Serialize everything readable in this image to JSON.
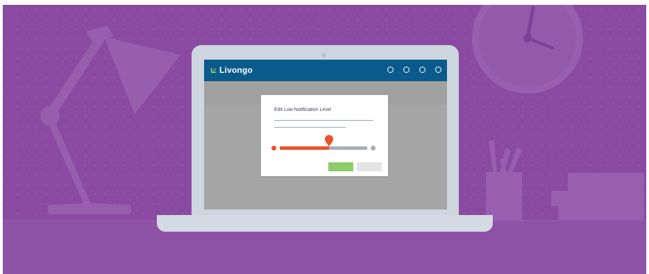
{
  "app": {
    "brand_name": "Livongo",
    "logo_icon": "livongo-leaf-icon",
    "header_color": "#0b5a8c",
    "nav_dots": [
      "nav-dot-1",
      "nav-dot-2",
      "nav-dot-3",
      "nav-dot-4"
    ]
  },
  "dialog": {
    "title": "Edit Low Notification Level",
    "slider": {
      "value_fraction": 0.56,
      "fill_color": "#e8542f",
      "track_color": "#a9b0b8"
    },
    "save_button_label": "",
    "cancel_button_label": ""
  },
  "colors": {
    "background": "#8a4aa1",
    "save_button": "#8ecb69",
    "cancel_button": "#e4e4e4",
    "accent": "#e8542f"
  }
}
